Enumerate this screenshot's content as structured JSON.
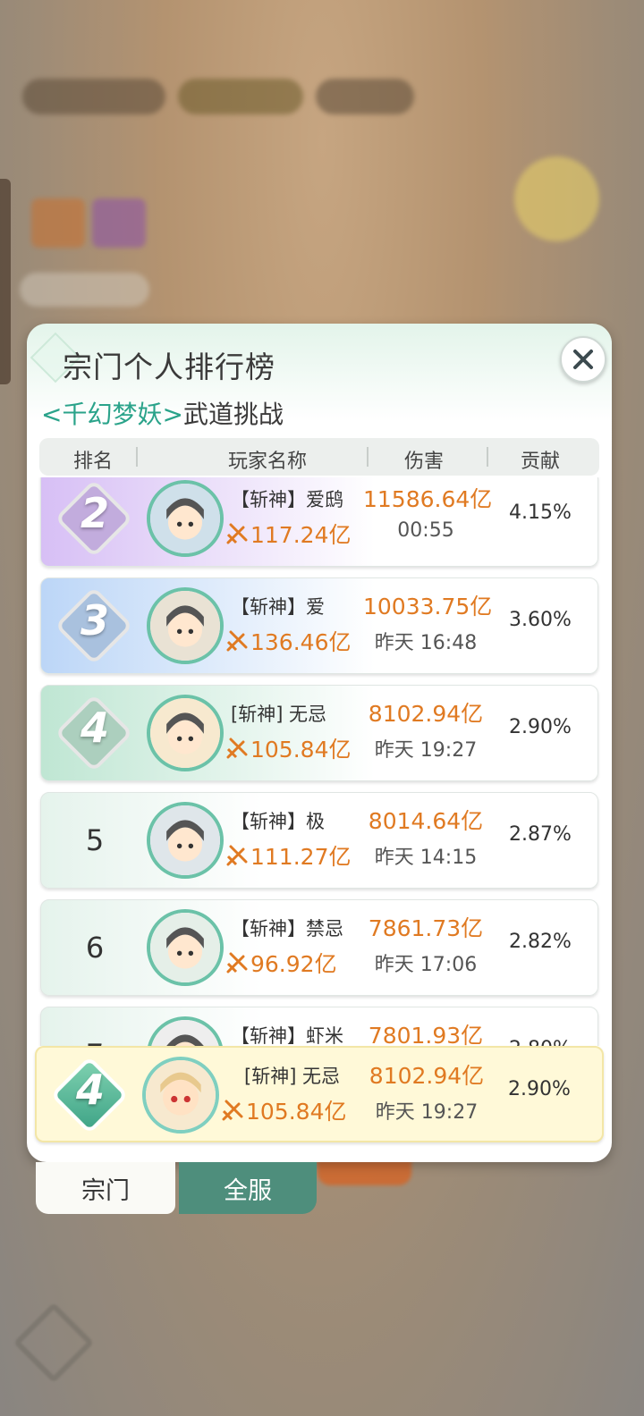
{
  "panel": {
    "title": "宗门个人排行榜",
    "subtitle_boss": "<千幻梦妖>",
    "subtitle_mode": "武道挑战",
    "columns": [
      "排名",
      "玩家名称",
      "伤害",
      "贡献"
    ]
  },
  "rows": [
    {
      "rank": "2",
      "name": "【斩神】爱鸱",
      "power": "117.24亿",
      "damage": "11586.64亿",
      "time": "00:55",
      "contribution": "4.15%",
      "bg": "#d7bff5"
    },
    {
      "rank": "3",
      "name": "【斩神】爱",
      "power": "136.46亿",
      "damage": "10033.75亿",
      "time": "昨天 16:48",
      "contribution": "3.60%",
      "bg": "#bcd6f7"
    },
    {
      "rank": "4",
      "name": "[斩神] 无忌",
      "power": "105.84亿",
      "damage": "8102.94亿",
      "time": "昨天 19:27",
      "contribution": "2.90%",
      "bg": "#bfe6d3"
    },
    {
      "rank": "5",
      "name": "【斩神】极",
      "power": "111.27亿",
      "damage": "8014.64亿",
      "time": "昨天 14:15",
      "contribution": "2.87%"
    },
    {
      "rank": "6",
      "name": "【斩神】禁忌",
      "power": "96.92亿",
      "damage": "7861.73亿",
      "time": "昨天 17:06",
      "contribution": "2.82%"
    },
    {
      "rank": "7",
      "name": "【斩神】虾米",
      "power": "",
      "damage": "7801.93亿",
      "time": "",
      "contribution": "2.80%"
    }
  ],
  "my_row": {
    "rank": "4",
    "name": "[斩神] 无忌",
    "power": "105.84亿",
    "damage": "8102.94亿",
    "time": "昨天 19:27",
    "contribution": "2.90%"
  },
  "tabs": {
    "sect": "宗门",
    "all": "全服"
  },
  "icons": {
    "close": "close-icon",
    "sword": "sword-icon"
  },
  "colors": {
    "accent": "#2aa38a",
    "damage": "#e07a22",
    "tab_active": "#4e8e7c",
    "my_row_bg": "#fff9d8"
  }
}
